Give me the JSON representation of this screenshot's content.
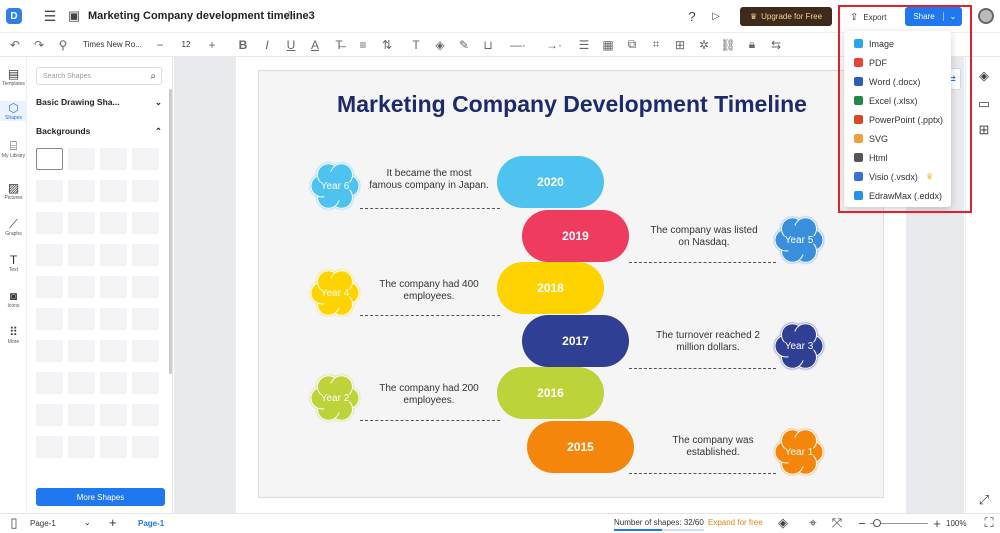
{
  "titlebar": {
    "doc_title": "Marketing Company development timeline3",
    "upgrade_label": "Upgrade for Free",
    "export_label": "Export",
    "share_label": "Share"
  },
  "toolbar": {
    "font": "Times New Ro...",
    "size": "12"
  },
  "rail": {
    "items": [
      "Templates",
      "Shapes",
      "My Library",
      "Pictures",
      "Graphs",
      "Text",
      "Icons",
      "More"
    ]
  },
  "panel": {
    "search_placeholder": "Search Shapes",
    "basic_label": "Basic Drawing Sha...",
    "backgrounds_label": "Backgrounds",
    "more_shapes_label": "More Shapes"
  },
  "diagram": {
    "title": "Marketing Company Development Timeline",
    "pills": [
      {
        "year": "2020",
        "color": "#4ec3ef"
      },
      {
        "year": "2019",
        "color": "#ef3c5e"
      },
      {
        "year": "2018",
        "color": "#ffd300"
      },
      {
        "year": "2017",
        "color": "#2f3f94"
      },
      {
        "year": "2016",
        "color": "#bdd339"
      },
      {
        "year": "2015",
        "color": "#f4870b"
      }
    ],
    "flowers": [
      {
        "label": "Year 6",
        "color": "#4ec3ef"
      },
      {
        "label": "Year 5",
        "color": "#3a8fdc"
      },
      {
        "label": "Year 4",
        "color": "#ffd300"
      },
      {
        "label": "Year 3",
        "color": "#2f3f94"
      },
      {
        "label": "Year 2",
        "color": "#bdd339"
      },
      {
        "label": "Year 1",
        "color": "#f4870b"
      }
    ],
    "descs": [
      "It became the most famous company in Japan.",
      "The company was listed on Nasdaq.",
      "The company had 400 employees.",
      "The turnover  reached 2 million dollars.",
      "The company had 200 employees.",
      "The company was established."
    ]
  },
  "menu": {
    "items": [
      {
        "label": "Image",
        "icon": "image-file-icon",
        "color": "#2aa7e8"
      },
      {
        "label": "PDF",
        "icon": "pdf-file-icon",
        "color": "#e8433a"
      },
      {
        "label": "Word (.docx)",
        "icon": "word-file-icon",
        "color": "#2b5fb8"
      },
      {
        "label": "Excel (.xlsx)",
        "icon": "excel-file-icon",
        "color": "#21874b"
      },
      {
        "label": "PowerPoint (.pptx)",
        "icon": "powerpoint-file-icon",
        "color": "#d24a26"
      },
      {
        "label": "SVG",
        "icon": "svg-file-icon",
        "color": "#f0a03a"
      },
      {
        "label": "Html",
        "icon": "html-file-icon",
        "color": "#555555"
      },
      {
        "label": "Visio (.vsdx)",
        "icon": "visio-file-icon",
        "color": "#3a6fd8"
      },
      {
        "label": "EdrawMax (.eddx)",
        "icon": "edrawmax-file-icon",
        "color": "#2a8fe8"
      }
    ]
  },
  "status": {
    "page_select": "Page-1",
    "page_tab": "Page-1",
    "shapes_count": "Number of shapes: 32/60",
    "expand": "Expand for free",
    "zoom": "100%"
  }
}
